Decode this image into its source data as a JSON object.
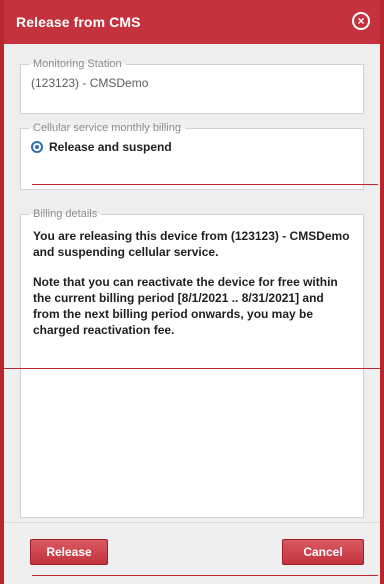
{
  "dialog": {
    "title": "Release from CMS"
  },
  "monitoring": {
    "legend": "Monitoring Station",
    "value": "(123123) - CMSDemo"
  },
  "cellular": {
    "legend": "Cellular service monthly billing",
    "option_label": "Release and suspend"
  },
  "billing": {
    "legend": "Billing details",
    "paragraph1": "You are releasing this device from (123123) - CMSDemo and suspending cellular service.",
    "paragraph2": "Note that you can reactivate the device for free within the current billing period [8/1/2021 .. 8/31/2021] and from the next billing period onwards, you may be charged reactivation fee."
  },
  "footer": {
    "release_label": "Release",
    "cancel_label": "Cancel"
  },
  "icons": {
    "close": "close-icon",
    "radio": "radio-selected-icon"
  },
  "colors": {
    "brand_red": "#c4323d",
    "border_red": "#b8262f",
    "radio_blue": "#2f6fb1"
  }
}
